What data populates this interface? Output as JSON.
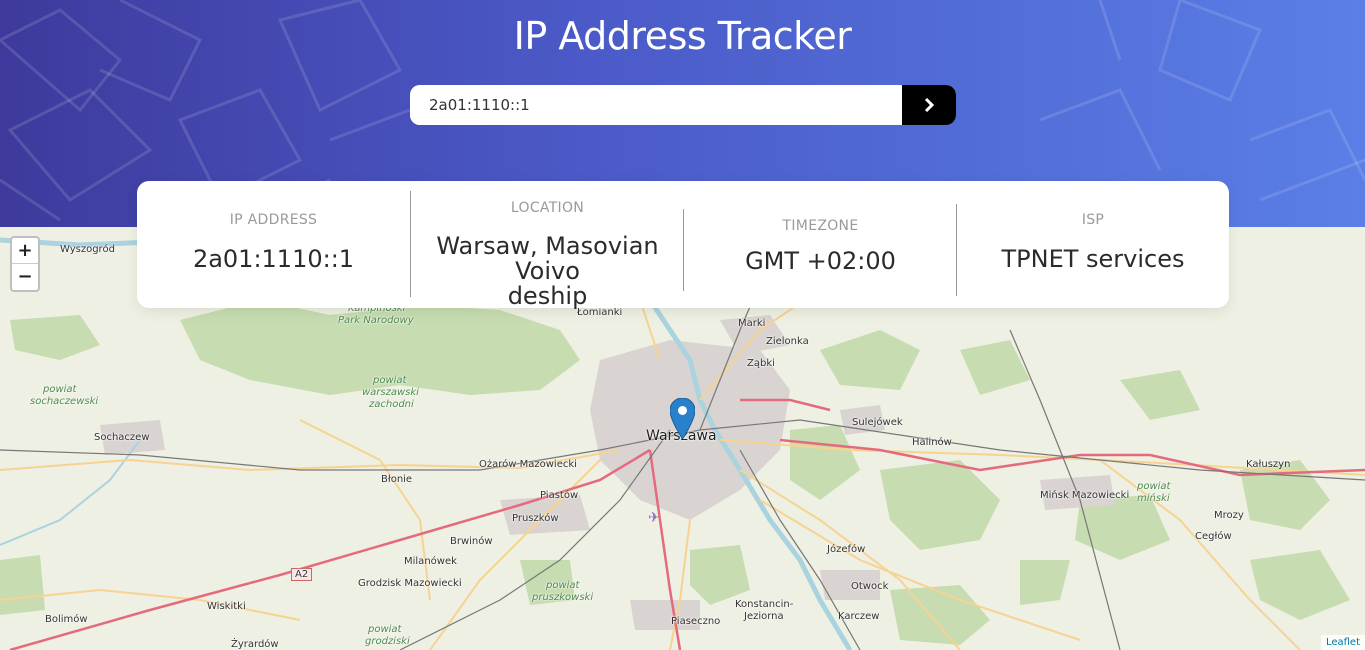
{
  "header": {
    "title": "IP Address Tracker",
    "search": {
      "value": "2a01:1110::1"
    }
  },
  "info": {
    "ip": {
      "label": "IP Address",
      "value": "2a01:1110::1"
    },
    "location": {
      "label": "Location",
      "value_line1": "Warsaw, Masovian Voivo",
      "value_line2": "deship"
    },
    "timezone": {
      "label": "Timezone",
      "value": "GMT +02:00"
    },
    "isp": {
      "label": "ISP",
      "value": "TPNET services"
    }
  },
  "map": {
    "zoom_in": "+",
    "zoom_out": "−",
    "attribution": "Leaflet",
    "places": {
      "wyszogrod": "Wyszogród",
      "lomianki": "Łomianki",
      "kampinoski1": "Kampinoski",
      "kampinoski2": "Park Narodowy",
      "marki": "Marki",
      "zielonka": "Zielonka",
      "zabki": "Ząbki",
      "pow_soch1": "powiat",
      "pow_soch2": "sochaczewski",
      "pow_wz1": "powiat",
      "pow_wz2": "warszawski",
      "pow_wz3": "zachodni",
      "sochaczew": "Sochaczew",
      "warszawa": "Warszawa",
      "sulejowek": "Sulejówek",
      "halinow": "Halinów",
      "kaluszyn": "Kałuszyn",
      "ozarow": "Ożarów Mazowiecki",
      "blonie": "Błonie",
      "piastow": "Piastów",
      "minsk": "Mińsk Mazowiecki",
      "pow_minski1": "powiat",
      "pow_minski2": "miński",
      "mrozy": "Mrozy",
      "pruszkow": "Pruszków",
      "brwinow": "Brwinów",
      "jozefow": "Józefów",
      "ceglow": "Cegłów",
      "a2": "A2",
      "milanowek": "Milanówek",
      "grodzisk": "Grodzisk Mazowiecki",
      "pow_prusz1": "powiat",
      "pow_prusz2": "pruszkowski",
      "otwock": "Otwock",
      "wiskitki": "Wiskitki",
      "konstancin1": "Konstancin-",
      "konstancin2": "Jeziorna",
      "karczew": "Karczew",
      "bolimow": "Bolimów",
      "piaseczno": "Piaseczno",
      "pow_grodz1": "powiat",
      "pow_grodz2": "grodziski",
      "zyrardow": "Żyrardów"
    }
  },
  "colors": {
    "header_start": "#3e3a9c",
    "header_end": "#5a7fe6",
    "button": "#000000",
    "marker": "#2a81cb",
    "motorway": "#e46b7d",
    "primary_road": "#f2b45f"
  },
  "icons": {
    "search_button": "chevron-right-icon",
    "marker": "map-marker-icon"
  }
}
